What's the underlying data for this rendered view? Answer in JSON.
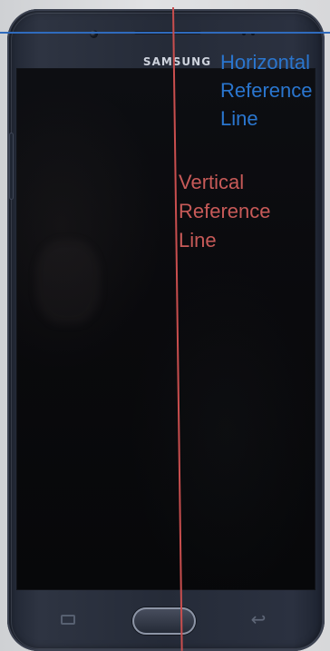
{
  "image": {
    "brand": "SAMSUNG",
    "colors": {
      "background": "#d8d9db",
      "phone_body": "#2a3040",
      "screen": "#090a0d",
      "horizontal_reference": "#2f6bbd",
      "vertical_reference": "#c94e4e"
    },
    "icons": {
      "camera": "front-camera-icon",
      "recent": "recent-apps-icon",
      "home": "home-button-icon",
      "back": "back-icon"
    }
  },
  "annotations": {
    "horizontal_label": "Horizontal\nReference\nLine",
    "vertical_label": "Vertical\nReference\nLine"
  }
}
